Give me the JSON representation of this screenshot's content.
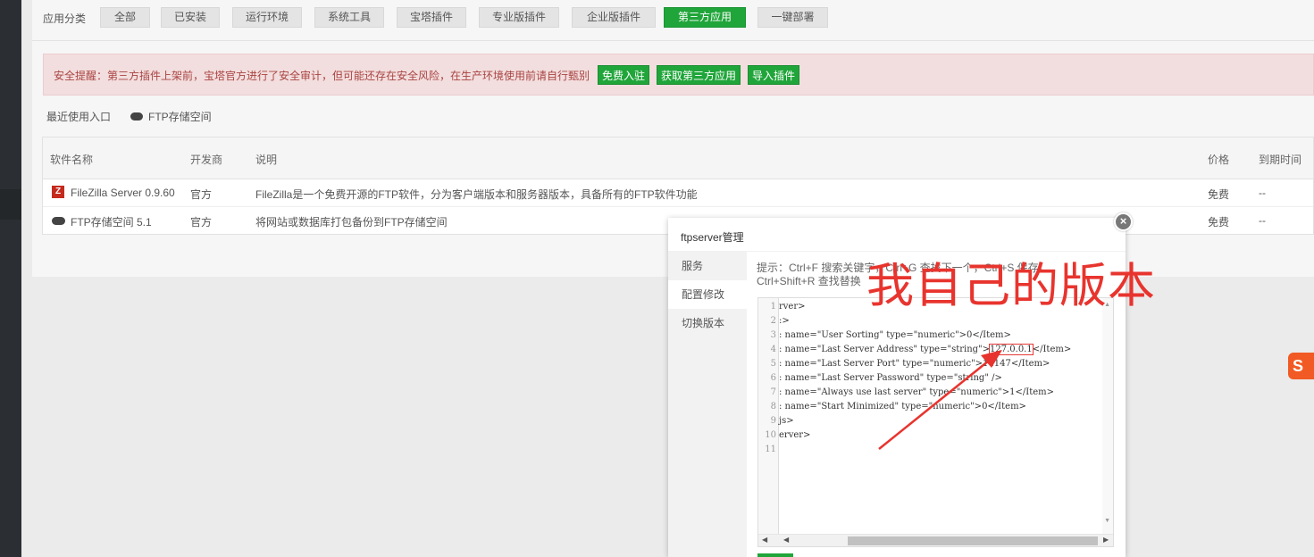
{
  "categories": {
    "label": "应用分类",
    "items": [
      "全部",
      "已安装",
      "运行环境",
      "系统工具",
      "宝塔插件",
      "专业版插件",
      "企业版插件",
      "第三方应用",
      "一键部署"
    ],
    "active_index": 7
  },
  "alert": {
    "text": "安全提醒：第三方插件上架前，宝塔官方进行了安全审计，但可能还存在安全风险，在生产环境使用前请自行甄别",
    "buttons": [
      "免费入驻",
      "获取第三方应用",
      "导入插件"
    ]
  },
  "recent": {
    "label": "最近使用入口",
    "items": [
      "FTP存储空间"
    ]
  },
  "table": {
    "headers": [
      "软件名称",
      "开发商",
      "说明",
      "价格",
      "到期时间"
    ],
    "rows": [
      {
        "name": "FileZilla Server 0.9.60",
        "vendor": "官方",
        "desc": "FileZilla是一个免费开源的FTP软件，分为客户端版本和服务器版本，具备所有的FTP软件功能",
        "price": "免费",
        "expire": "--"
      },
      {
        "name": "FTP存储空间 5.1",
        "vendor": "官方",
        "desc": "将网站或数据库打包备份到FTP存储空间",
        "price": "免费",
        "expire": "--"
      }
    ]
  },
  "dialog": {
    "title": "ftpserver管理",
    "close_glyph": "×",
    "menu": [
      "服务",
      "配置修改",
      "切换版本"
    ],
    "active_menu": 1,
    "hint_line1": "提示：Ctrl+F 搜索关键字，Ctrl+G 查找下一个，Ctrl+S 保存，",
    "hint_line2": "Ctrl+Shift+R 查找替换",
    "editor": {
      "lines": [
        {
          "num": "1",
          "text": "rver>"
        },
        {
          "num": "2",
          "text": ":>"
        },
        {
          "num": "3",
          "text": ": name=\"User Sorting\" type=\"numeric\">0</Item>"
        },
        {
          "num": "4",
          "pre": ": name=\"Last Server Address\" type=\"string\">",
          "hl": "127.0.0.1",
          "post": "</Item>"
        },
        {
          "num": "5",
          "text": ": name=\"Last Server Port\" type=\"numeric\">14147</Item>"
        },
        {
          "num": "6",
          "text": ": name=\"Last Server Password\" type=\"string\" />"
        },
        {
          "num": "7",
          "text": ": name=\"Always use last server\" type=\"numeric\">1</Item>"
        },
        {
          "num": "8",
          "text": ": name=\"Start Minimized\" type=\"numeric\">0</Item>"
        },
        {
          "num": "9",
          "text": "js>"
        },
        {
          "num": "10",
          "text": "erver>"
        },
        {
          "num": "11",
          "text": ""
        }
      ]
    }
  },
  "annotation": {
    "text": "我自己的版本",
    "color": "#e8342e"
  },
  "tray": {
    "glyph": "S"
  },
  "colors": {
    "accent": "#20a53a",
    "alert_text": "#a94442",
    "alert_bg": "#f2dede"
  }
}
